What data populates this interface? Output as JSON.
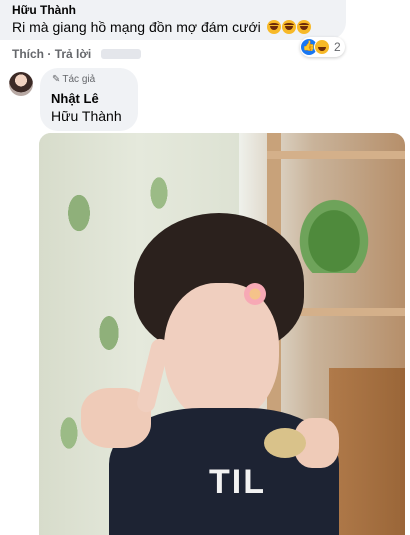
{
  "comment1": {
    "author": "Hữu Thành",
    "text": "Ri mà giang hồ mạng đồn mợ đám cưới",
    "emoji": "laughing-emoji",
    "actions": {
      "like": "Thích",
      "separator": "·",
      "reply": "Trả lời"
    },
    "reaction_count": "2",
    "reaction_icons": [
      "like-icon",
      "haha-icon"
    ]
  },
  "comment2": {
    "author_badge": "Tác giả",
    "author": "Nhật Lê",
    "text": "Hữu Thành"
  },
  "photo": {
    "shirt_text": "TIL"
  },
  "colors": {
    "bubble_bg": "#f0f2f5",
    "secondary_text": "#65676b",
    "like_blue": "#1877f2",
    "haha_yellow": "#f7b928"
  }
}
